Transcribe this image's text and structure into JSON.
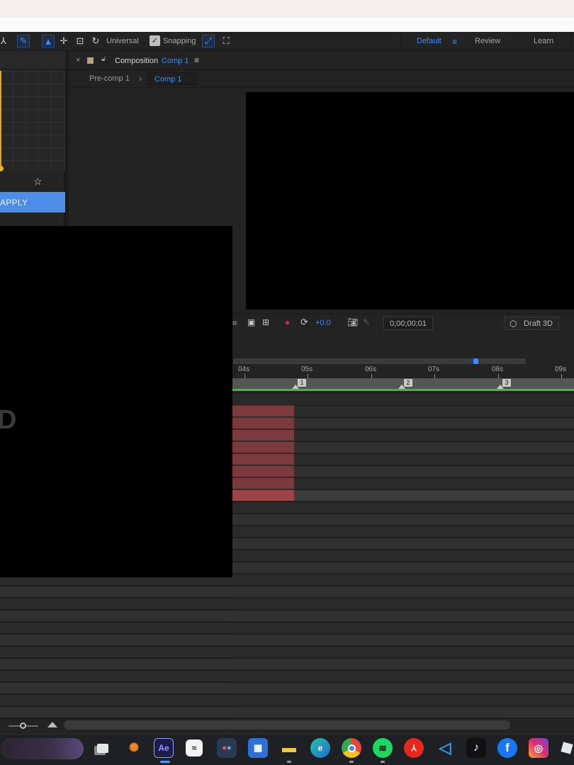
{
  "toolbar": {
    "universal_label": "Universal",
    "snapping_label": "Snapping",
    "workspaces": [
      "Default",
      "Review",
      "Learn"
    ]
  },
  "left_panel": {
    "apply_label": "APPLY"
  },
  "composition": {
    "tab_prefix": "Composition",
    "tab_name": "Comp 1",
    "breadcrumbs": [
      "Pre-comp 1",
      "Comp 1"
    ],
    "exposure": "+0.0",
    "timecode": "0;00;00;01",
    "renderer": "Draft 3D"
  },
  "timeline": {
    "ruler_labels": [
      "04s",
      "05s",
      "06s",
      "07s",
      "08s",
      "09s"
    ],
    "markers": [
      "1",
      "2",
      "3"
    ]
  },
  "overlay": {
    "glyph": "D"
  },
  "taskbar": {
    "apps": [
      "start",
      "task-view",
      "blender",
      "after-effects",
      "capcut",
      "davinci-resolve",
      "microsoft-store",
      "file-explorer",
      "edge",
      "chrome",
      "spotify",
      "acrobat",
      "vscode",
      "tiktok",
      "facebook",
      "instagram",
      "roblox"
    ],
    "ae_label": "Ae"
  },
  "colors": {
    "accent": "#3a8bff",
    "layer_red": "#7a3a3e",
    "work_area_green": "#37c13a",
    "keyframe_yellow": "#e6a51e"
  }
}
